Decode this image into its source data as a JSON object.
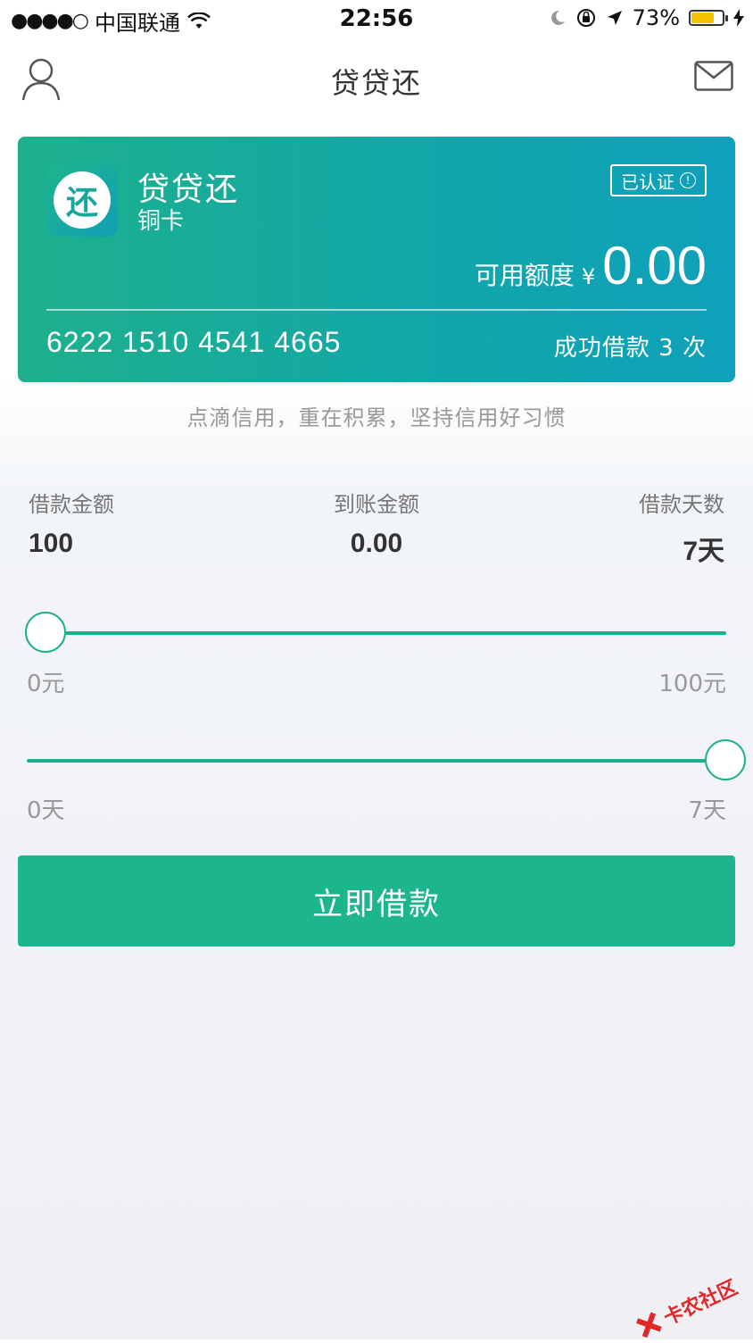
{
  "status_bar": {
    "carrier": "中国联通",
    "signal": "●●●●○",
    "time": "22:56",
    "battery": "73%",
    "battery_level": 0.73
  },
  "nav": {
    "title": "贷贷还"
  },
  "card": {
    "logo_char": "还",
    "name": "贷贷还",
    "level": "铜卡",
    "badge": "已认证",
    "credit_label": "可用额度",
    "currency": "¥",
    "credit_amount": "0.00",
    "card_number": "6222 1510 4541 4665",
    "success_count": "成功借款 3 次"
  },
  "slogan": "点滴信用，重在积累，坚持信用好习惯",
  "summary": {
    "loan_amount_label": "借款金额",
    "loan_amount": "100",
    "received_label": "到账金额",
    "received": "0.00",
    "days_label": "借款天数",
    "days": "7天"
  },
  "amount_slider": {
    "min_label": "0元",
    "max_label": "100元",
    "position": 0.0
  },
  "days_slider": {
    "min_label": "0天",
    "max_label": "7天",
    "position": 1.0
  },
  "cta": {
    "label": "立即借款"
  },
  "watermark": {
    "text": "卡农社区"
  },
  "colors": {
    "accent": "#1db58e",
    "card_start": "#1eb08c",
    "card_end": "#0fa0bb"
  }
}
